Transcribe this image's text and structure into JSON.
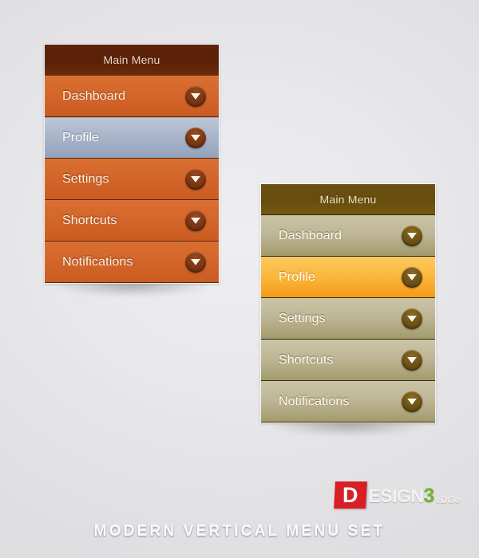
{
  "page": {
    "background_color": "#e8e8ea",
    "footer_title": "MODERN VERTICAL MENU SET"
  },
  "logo": {
    "d": "D",
    "esign": "ESIGN",
    "three": "3",
    "edge": "eDGe",
    "red": "#d91f26",
    "green": "#6cb52d"
  },
  "menus": [
    {
      "id": "orange",
      "header": "Main Menu",
      "theme_base_color": "#d4652a",
      "theme_header_color": "#5a2108",
      "active_color": "#aab5ca",
      "items": [
        {
          "label": "Dashboard",
          "active": false,
          "icon": "chevron-down-icon"
        },
        {
          "label": "Profile",
          "active": true,
          "icon": "chevron-down-icon"
        },
        {
          "label": "Settings",
          "active": false,
          "icon": "chevron-down-icon"
        },
        {
          "label": "Shortcuts",
          "active": false,
          "icon": "chevron-down-icon"
        },
        {
          "label": "Notifications",
          "active": false,
          "icon": "chevron-down-icon"
        }
      ]
    },
    {
      "id": "gold",
      "header": "Main Menu",
      "theme_base_color": "#bdb594",
      "theme_header_color": "#674d0e",
      "active_color": "#fab93f",
      "items": [
        {
          "label": "Dashboard",
          "active": false,
          "icon": "chevron-down-icon"
        },
        {
          "label": "Profile",
          "active": true,
          "icon": "chevron-down-icon"
        },
        {
          "label": "Settings",
          "active": false,
          "icon": "chevron-down-icon"
        },
        {
          "label": "Shortcuts",
          "active": false,
          "icon": "chevron-down-icon"
        },
        {
          "label": "Notifications",
          "active": false,
          "icon": "chevron-down-icon"
        }
      ]
    }
  ]
}
